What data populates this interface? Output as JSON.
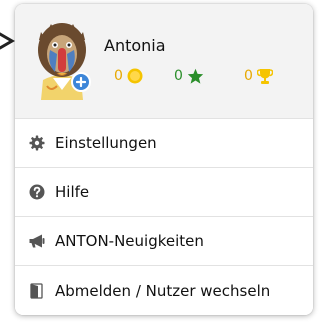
{
  "profile": {
    "name": "Antonia",
    "coins": "0",
    "stars": "0",
    "trophies": "0"
  },
  "menu": {
    "items": [
      {
        "label": "Einstellungen",
        "icon": "gear-icon"
      },
      {
        "label": "Hilfe",
        "icon": "help-circle-icon"
      },
      {
        "label": "ANTON-Neuigkeiten",
        "icon": "megaphone-icon"
      },
      {
        "label": "Abmelden / Nutzer wechseln",
        "icon": "door-exit-icon"
      }
    ]
  },
  "colors": {
    "header_bg": "#f3f3f3",
    "coin": "#f5c400",
    "star": "#2a8e2a",
    "trophy": "#f5c400",
    "badge": "#3d86d8",
    "icon": "#555555"
  }
}
